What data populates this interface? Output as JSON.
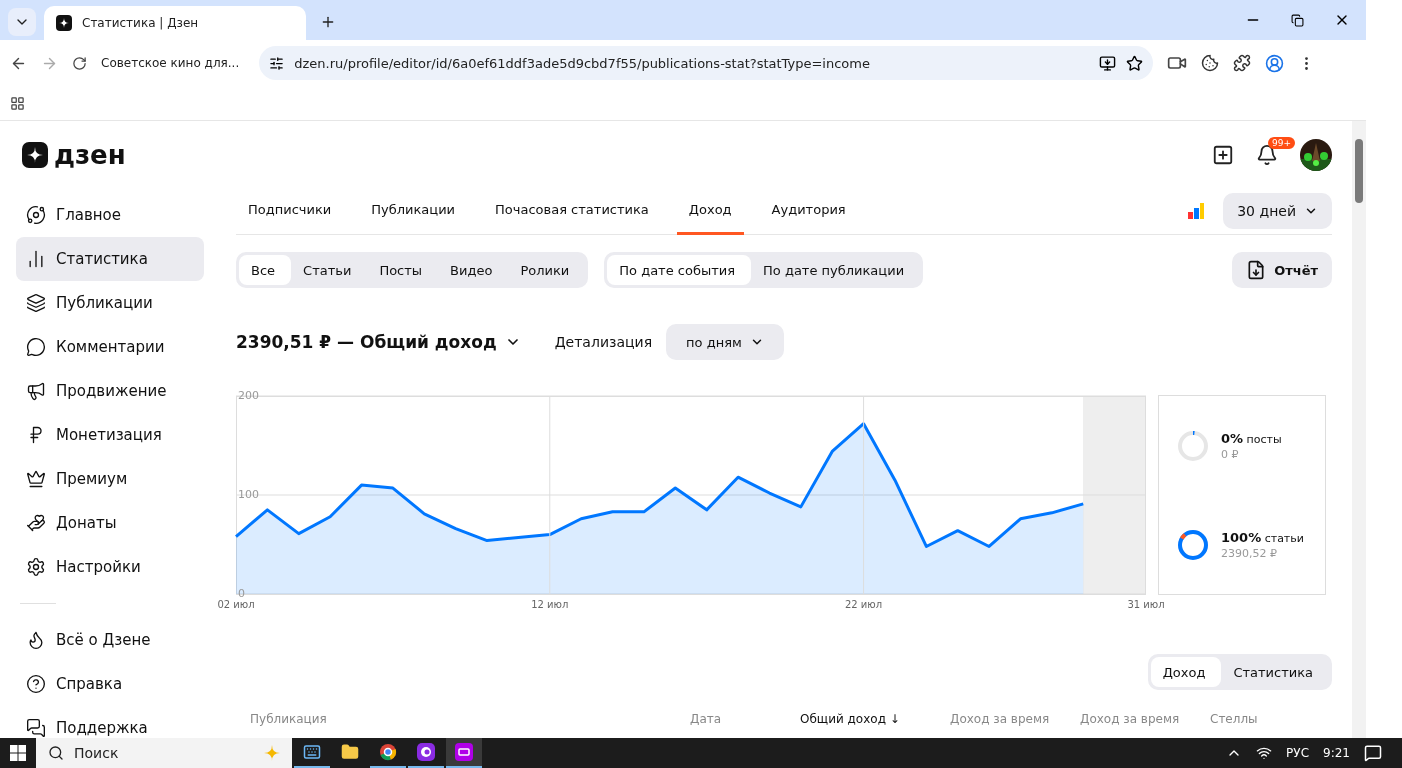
{
  "browser": {
    "tab_title": "Статистика | Дзен",
    "bookmark": "Советское кино для...",
    "url": "dzen.ru/profile/editor/id/6a0ef61ddf3ade5d9cbd7f55/publications-stat?statType=income"
  },
  "header": {
    "logo": "дзен",
    "notifications_badge": "99+"
  },
  "sidebar": {
    "items": [
      {
        "label": "Главное",
        "selected": false
      },
      {
        "label": "Статистика",
        "selected": true
      },
      {
        "label": "Публикации",
        "selected": false
      },
      {
        "label": "Комментарии",
        "selected": false
      },
      {
        "label": "Продвижение",
        "selected": false
      },
      {
        "label": "Монетизация",
        "selected": false
      },
      {
        "label": "Премиум",
        "selected": false
      },
      {
        "label": "Донаты",
        "selected": false
      },
      {
        "label": "Настройки",
        "selected": false
      }
    ],
    "footer_items": [
      {
        "label": "Всё о Дзене"
      },
      {
        "label": "Справка"
      },
      {
        "label": "Поддержка"
      }
    ]
  },
  "tabs": [
    {
      "label": "Подписчики",
      "selected": false
    },
    {
      "label": "Публикации",
      "selected": false
    },
    {
      "label": "Почасовая статистика",
      "selected": false
    },
    {
      "label": "Доход",
      "selected": true
    },
    {
      "label": "Аудитория",
      "selected": false
    }
  ],
  "period": "30 дней",
  "type_filter": [
    {
      "label": "Все",
      "selected": true
    },
    {
      "label": "Статьи",
      "selected": false
    },
    {
      "label": "Посты",
      "selected": false
    },
    {
      "label": "Видео",
      "selected": false
    },
    {
      "label": "Ролики",
      "selected": false
    }
  ],
  "date_filter": [
    {
      "label": "По дате события",
      "selected": true
    },
    {
      "label": "По дате публикации",
      "selected": false
    }
  ],
  "report_button": "Отчёт",
  "total": "2390,51 ₽ — Общий доход",
  "detail_label": "Детализация",
  "detail_value": "по дням",
  "chart_data": {
    "type": "area",
    "x": [
      2,
      3,
      4,
      5,
      6,
      7,
      8,
      9,
      10,
      11,
      12,
      13,
      14,
      15,
      16,
      17,
      18,
      19,
      20,
      21,
      22,
      23,
      24,
      25,
      26,
      27,
      28,
      29
    ],
    "grid": true,
    "series": [
      {
        "color": "#0077ff",
        "values": [
          58,
          85,
          61,
          78,
          110,
          107,
          81,
          66,
          54,
          57,
          60,
          76,
          83,
          83,
          107,
          85,
          118,
          102,
          88,
          144,
          172,
          115,
          48,
          64,
          48,
          76,
          82,
          91
        ]
      }
    ],
    "xlim": [
      2,
      31
    ],
    "ylim": [
      0,
      200
    ],
    "yticks": [
      0,
      100,
      200
    ],
    "xticks": [
      {
        "value": 2,
        "label": "02 июл"
      },
      {
        "value": 12,
        "label": "12 июл"
      },
      {
        "value": 22,
        "label": "22 июл"
      },
      {
        "value": 31,
        "label": "31 июл"
      }
    ]
  },
  "breakdown": [
    {
      "percent": "0%",
      "label": "посты",
      "amount": "0 ₽"
    },
    {
      "percent": "100%",
      "label": "статьи",
      "amount": "2390,52 ₽"
    }
  ],
  "table_toggle": [
    {
      "label": "Доход",
      "selected": true
    },
    {
      "label": "Статистика",
      "selected": false
    }
  ],
  "table": {
    "columns": [
      {
        "label": "Публикация",
        "sorted": false
      },
      {
        "label": "Дата",
        "sorted": false
      },
      {
        "label": "Общий доход ↓",
        "sorted": true
      },
      {
        "label": "Доход за время",
        "sorted": false
      },
      {
        "label": "Доход за время",
        "sorted": false
      },
      {
        "label": "Стеллы",
        "sorted": false
      }
    ]
  },
  "taskbar": {
    "search": "Поиск",
    "apps": [
      {
        "kind": "keyboard",
        "running": true,
        "selected": false
      },
      {
        "kind": "folder",
        "running": false,
        "selected": false
      },
      {
        "kind": "browser",
        "running": true,
        "selected": false
      },
      {
        "kind": "player",
        "running": true,
        "selected": false
      },
      {
        "kind": "editor",
        "running": true,
        "selected": true
      }
    ],
    "language": "РУС",
    "time": "9:21"
  }
}
